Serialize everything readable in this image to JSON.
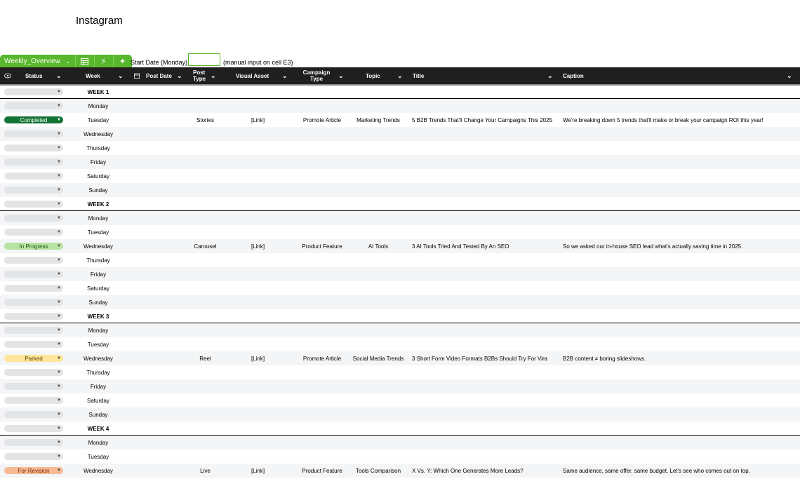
{
  "page": {
    "title": "Instagram"
  },
  "toolbar": {
    "view_tab": "Weekly_Overview",
    "icons": [
      "table-view-icon",
      "lightning-icon",
      "sparkle-icon"
    ],
    "accent": "#58b72c"
  },
  "start": {
    "label": "Start Date (Monday)",
    "value": "",
    "note": "(manual input on cell E3)"
  },
  "columns": {
    "status": "Status",
    "week": "Week",
    "post_date": "Post Date",
    "post_type": "Post\nType",
    "visual_asset": "Visual Asset",
    "campaign_type": "Campaign\nType",
    "topic": "Topic",
    "title": "Title",
    "caption": "Caption"
  },
  "status_colors": {
    "Completed": "#137333",
    "In Progress": "#b7e3a1",
    "Parked": "#ffe599",
    "For Revision": "#f8b995"
  },
  "rows": [
    {
      "type": "week",
      "status": "",
      "week": "WEEK 1"
    },
    {
      "type": "day",
      "status": "",
      "week": "Monday"
    },
    {
      "type": "day",
      "status": "Completed",
      "week": "Tuesday",
      "post_type": "Stories",
      "asset": "[Link]",
      "campaign": "Promote Article",
      "topic": "Marketing Trends",
      "title": "5 B2B Trends That'll Change Your Campaigns This 2025",
      "caption": "We're breaking down 5 trends that'll make or break your campaign ROI this year!"
    },
    {
      "type": "day",
      "status": "",
      "week": "Wednesday"
    },
    {
      "type": "day",
      "status": "",
      "week": "Thursday"
    },
    {
      "type": "day",
      "status": "",
      "week": "Friday"
    },
    {
      "type": "day",
      "status": "",
      "week": "Saturday"
    },
    {
      "type": "day",
      "status": "",
      "week": "Sunday"
    },
    {
      "type": "week",
      "status": "",
      "week": "WEEK 2"
    },
    {
      "type": "day",
      "status": "",
      "week": "Monday"
    },
    {
      "type": "day",
      "status": "",
      "week": "Tuesday"
    },
    {
      "type": "day",
      "status": "In Progress",
      "week": "Wednesday",
      "post_type": "Carousel",
      "asset": "[Link]",
      "campaign": "Product Feature",
      "topic": "AI Tools",
      "title": "3 AI Tools Tried And Tested By An SEO",
      "caption": "So we asked our in-house SEO lead what's actually saving time in 2025."
    },
    {
      "type": "day",
      "status": "",
      "week": "Thursday"
    },
    {
      "type": "day",
      "status": "",
      "week": "Friday"
    },
    {
      "type": "day",
      "status": "",
      "week": "Saturday"
    },
    {
      "type": "day",
      "status": "",
      "week": "Sunday"
    },
    {
      "type": "week",
      "status": "",
      "week": "WEEK 3"
    },
    {
      "type": "day",
      "status": "",
      "week": "Monday"
    },
    {
      "type": "day",
      "status": "",
      "week": "Tuesday"
    },
    {
      "type": "day",
      "status": "Parked",
      "week": "Wednesday",
      "post_type": "Reel",
      "asset": "[Link]",
      "campaign": "Promote Article",
      "topic": "Social Media Trends",
      "title": "3 Short Form Video Formats B2Bs Should Try For Vira",
      "caption": "B2B content ≠ boring slideshows."
    },
    {
      "type": "day",
      "status": "",
      "week": "Thursday"
    },
    {
      "type": "day",
      "status": "",
      "week": "Friday"
    },
    {
      "type": "day",
      "status": "",
      "week": "Saturday"
    },
    {
      "type": "day",
      "status": "",
      "week": "Sunday"
    },
    {
      "type": "week",
      "status": "",
      "week": "WEEK 4"
    },
    {
      "type": "day",
      "status": "",
      "week": "Monday"
    },
    {
      "type": "day",
      "status": "",
      "week": "Tuesday"
    },
    {
      "type": "day",
      "status": "For Revision",
      "week": "Wednesday",
      "post_type": "Live",
      "asset": "[Link]",
      "campaign": "Product Feature",
      "topic": "Tools Comparison",
      "title": "X Vs. Y: Which One Generates More Leads?",
      "caption": "Same audience, same offer, same budget. Let's see who comes out on top."
    }
  ]
}
